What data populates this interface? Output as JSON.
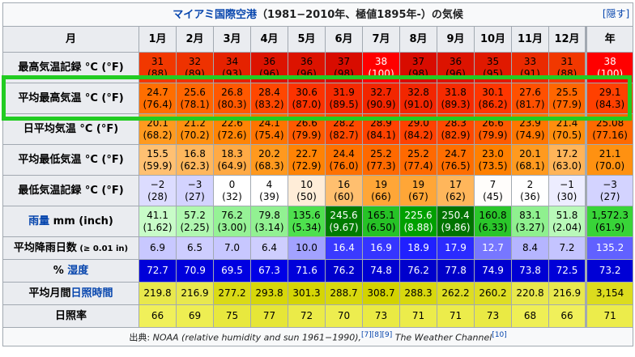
{
  "caption": {
    "title": "マイアミ国際空港",
    "rest": "（1981−2010年、極値1895年-）の気候",
    "hide": "[隠す]"
  },
  "header": {
    "corner": "月",
    "months": [
      "1月",
      "2月",
      "3月",
      "4月",
      "5月",
      "6月",
      "7月",
      "8月",
      "9月",
      "10月",
      "11月",
      "12月"
    ],
    "year": "年"
  },
  "rows": [
    {
      "label": "最高気温記録 °C (°F)",
      "link": false,
      "two_line": true,
      "cells": [
        {
          "a": "31",
          "b": "(88)",
          "bg": "#f13800",
          "fg": "#000000"
        },
        {
          "a": "32",
          "b": "(89)",
          "bg": "#ee3200",
          "fg": "#000000"
        },
        {
          "a": "34",
          "b": "(93)",
          "bg": "#e52200",
          "fg": "#000000"
        },
        {
          "a": "36",
          "b": "(96)",
          "bg": "#dc1300",
          "fg": "#000000"
        },
        {
          "a": "36",
          "b": "(96)",
          "bg": "#dc1300",
          "fg": "#000000"
        },
        {
          "a": "37",
          "b": "(98)",
          "bg": "#d80c00",
          "fg": "#000000"
        },
        {
          "a": "38",
          "b": "(100)",
          "bg": "#ff0000",
          "fg": "#ffffff"
        },
        {
          "a": "37",
          "b": "(98)",
          "bg": "#d80c00",
          "fg": "#000000"
        },
        {
          "a": "36",
          "b": "(96)",
          "bg": "#dc1300",
          "fg": "#000000"
        },
        {
          "a": "35",
          "b": "(95)",
          "bg": "#e01900",
          "fg": "#000000"
        },
        {
          "a": "33",
          "b": "(91)",
          "bg": "#ea2a00",
          "fg": "#000000"
        },
        {
          "a": "31",
          "b": "(88)",
          "bg": "#f13800",
          "fg": "#000000"
        },
        {
          "a": "38",
          "b": "(100)",
          "bg": "#ff0000",
          "fg": "#ffffff"
        }
      ]
    },
    {
      "label": "平均最高気温 °C (°F)",
      "link": false,
      "two_line": true,
      "cells": [
        {
          "a": "24.7",
          "b": "(76.4)",
          "bg": "#ff6e00",
          "fg": "#000000"
        },
        {
          "a": "25.6",
          "b": "(78.1)",
          "bg": "#ff6500",
          "fg": "#000000"
        },
        {
          "a": "26.8",
          "b": "(80.3)",
          "bg": "#ff5800",
          "fg": "#000000"
        },
        {
          "a": "28.4",
          "b": "(83.2)",
          "bg": "#ff4700",
          "fg": "#000000"
        },
        {
          "a": "30.6",
          "b": "(87.0)",
          "bg": "#fc3300",
          "fg": "#000000"
        },
        {
          "a": "31.9",
          "b": "(89.5)",
          "bg": "#f52a00",
          "fg": "#000000"
        },
        {
          "a": "32.7",
          "b": "(90.9)",
          "bg": "#f22600",
          "fg": "#000000"
        },
        {
          "a": "32.8",
          "b": "(91.0)",
          "bg": "#f22600",
          "fg": "#000000"
        },
        {
          "a": "31.8",
          "b": "(89.3)",
          "bg": "#f62b00",
          "fg": "#000000"
        },
        {
          "a": "30.1",
          "b": "(86.2)",
          "bg": "#fe3600",
          "fg": "#000000"
        },
        {
          "a": "27.6",
          "b": "(81.7)",
          "bg": "#ff5000",
          "fg": "#000000"
        },
        {
          "a": "25.5",
          "b": "(77.9)",
          "bg": "#ff6600",
          "fg": "#000000"
        },
        {
          "a": "29.1",
          "b": "(84.3)",
          "bg": "#ff4000",
          "fg": "#000000"
        }
      ]
    },
    {
      "label": "日平均気温 °C (°F)",
      "link": false,
      "two_line": true,
      "cells": [
        {
          "a": "20.1",
          "b": "(68.2)",
          "bg": "#ff9a1f",
          "fg": "#000000"
        },
        {
          "a": "21.2",
          "b": "(70.2)",
          "bg": "#ff9010",
          "fg": "#000000"
        },
        {
          "a": "22.6",
          "b": "(72.6)",
          "bg": "#ff8405",
          "fg": "#000000"
        },
        {
          "a": "24.1",
          "b": "(75.4)",
          "bg": "#ff7400",
          "fg": "#000000"
        },
        {
          "a": "26.6",
          "b": "(79.9)",
          "bg": "#ff5a00",
          "fg": "#000000"
        },
        {
          "a": "28.2",
          "b": "(82.7)",
          "bg": "#ff4a00",
          "fg": "#000000"
        },
        {
          "a": "28.9",
          "b": "(84.1)",
          "bg": "#ff4200",
          "fg": "#000000"
        },
        {
          "a": "29.0",
          "b": "(84.2)",
          "bg": "#ff4100",
          "fg": "#000000"
        },
        {
          "a": "28.3",
          "b": "(82.9)",
          "bg": "#ff4900",
          "fg": "#000000"
        },
        {
          "a": "26.6",
          "b": "(79.9)",
          "bg": "#ff5a00",
          "fg": "#000000"
        },
        {
          "a": "23.9",
          "b": "(74.9)",
          "bg": "#ff7600",
          "fg": "#000000"
        },
        {
          "a": "21.4",
          "b": "(70.5)",
          "bg": "#ff8e0e",
          "fg": "#000000"
        },
        {
          "a": "25.08",
          "b": "(77.16)",
          "bg": "#ff6a00",
          "fg": "#000000"
        }
      ]
    },
    {
      "label": "平均最低気温 °C (°F)",
      "link": false,
      "two_line": true,
      "cells": [
        {
          "a": "15.5",
          "b": "(59.9)",
          "bg": "#ffc072",
          "fg": "#000000"
        },
        {
          "a": "16.8",
          "b": "(62.3)",
          "bg": "#ffb75e",
          "fg": "#000000"
        },
        {
          "a": "18.3",
          "b": "(64.9)",
          "bg": "#ffaa45",
          "fg": "#000000"
        },
        {
          "a": "20.2",
          "b": "(68.3)",
          "bg": "#ff991e",
          "fg": "#000000"
        },
        {
          "a": "22.7",
          "b": "(72.9)",
          "bg": "#ff8304",
          "fg": "#000000"
        },
        {
          "a": "24.4",
          "b": "(76.0)",
          "bg": "#ff7100",
          "fg": "#000000"
        },
        {
          "a": "25.2",
          "b": "(77.3)",
          "bg": "#ff6900",
          "fg": "#000000"
        },
        {
          "a": "25.2",
          "b": "(77.4)",
          "bg": "#ff6900",
          "fg": "#000000"
        },
        {
          "a": "24.7",
          "b": "(76.5)",
          "bg": "#ff6e00",
          "fg": "#000000"
        },
        {
          "a": "23.0",
          "b": "(73.5)",
          "bg": "#ff8000",
          "fg": "#000000"
        },
        {
          "a": "20.1",
          "b": "(68.1)",
          "bg": "#ff9a1f",
          "fg": "#000000"
        },
        {
          "a": "17.2",
          "b": "(63.0)",
          "bg": "#ffb459",
          "fg": "#000000"
        },
        {
          "a": "21.1",
          "b": "(70.0)",
          "bg": "#ff9111",
          "fg": "#000000"
        }
      ]
    },
    {
      "label": "最低気温記録 °C (°F)",
      "link": false,
      "two_line": true,
      "cells": [
        {
          "a": "−2",
          "b": "(28)",
          "bg": "#dcdcff",
          "fg": "#000000"
        },
        {
          "a": "−3",
          "b": "(27)",
          "bg": "#d3d3ff",
          "fg": "#000000"
        },
        {
          "a": "0",
          "b": "(32)",
          "bg": "#ffffff",
          "fg": "#000000"
        },
        {
          "a": "4",
          "b": "(39)",
          "bg": "#ffffff",
          "fg": "#000000"
        },
        {
          "a": "10",
          "b": "(50)",
          "bg": "#ffedd8",
          "fg": "#000000"
        },
        {
          "a": "16",
          "b": "(60)",
          "bg": "#ffbf6f",
          "fg": "#000000"
        },
        {
          "a": "19",
          "b": "(66)",
          "bg": "#ffa637",
          "fg": "#000000"
        },
        {
          "a": "19",
          "b": "(67)",
          "bg": "#ffa637",
          "fg": "#000000"
        },
        {
          "a": "17",
          "b": "(62)",
          "bg": "#ffb65b",
          "fg": "#000000"
        },
        {
          "a": "7",
          "b": "(45)",
          "bg": "#fffdfb",
          "fg": "#000000"
        },
        {
          "a": "2",
          "b": "(36)",
          "bg": "#ffffff",
          "fg": "#000000"
        },
        {
          "a": "−1",
          "b": "(30)",
          "bg": "#ededff",
          "fg": "#000000"
        },
        {
          "a": "−3",
          "b": "(27)",
          "bg": "#d3d3ff",
          "fg": "#000000"
        }
      ]
    },
    {
      "label_link": "雨量",
      "label": " mm (inch)",
      "link": true,
      "two_line": true,
      "cells": [
        {
          "a": "41.1",
          "b": "(1.62)",
          "bg": "#c8fcc8",
          "fg": "#000000"
        },
        {
          "a": "57.2",
          "b": "(2.25)",
          "bg": "#b0f8b0",
          "fg": "#000000"
        },
        {
          "a": "76.2",
          "b": "(3.00)",
          "bg": "#96f296",
          "fg": "#000000"
        },
        {
          "a": "79.8",
          "b": "(3.14)",
          "bg": "#92f192",
          "fg": "#000000"
        },
        {
          "a": "135.6",
          "b": "(5.34)",
          "bg": "#4ee04e",
          "fg": "#000000"
        },
        {
          "a": "245.6",
          "b": "(9.67)",
          "bg": "#007c00",
          "fg": "#ffffff"
        },
        {
          "a": "165.1",
          "b": "(6.50)",
          "bg": "#26c226",
          "fg": "#000000"
        },
        {
          "a": "225.6",
          "b": "(8.88)",
          "bg": "#00a000",
          "fg": "#ffffff"
        },
        {
          "a": "250.4",
          "b": "(9.86)",
          "bg": "#007400",
          "fg": "#ffffff"
        },
        {
          "a": "160.8",
          "b": "(6.33)",
          "bg": "#2ac62a",
          "fg": "#000000"
        },
        {
          "a": "83.1",
          "b": "(3.27)",
          "bg": "#8ff08f",
          "fg": "#000000"
        },
        {
          "a": "51.8",
          "b": "(2.04)",
          "bg": "#b9f9b9",
          "fg": "#000000"
        },
        {
          "a": "1,572.3",
          "b": "(61.9)",
          "bg": "#38d438",
          "fg": "#000000"
        }
      ]
    },
    {
      "label": "平均降雨日数",
      "label_small": " (≥ 0.01 in)",
      "link": false,
      "two_line": false,
      "cells": [
        {
          "a": "6.9",
          "bg": "#c8c8ff",
          "fg": "#000000"
        },
        {
          "a": "6.5",
          "bg": "#cdcdff",
          "fg": "#000000"
        },
        {
          "a": "7.0",
          "bg": "#c7c7ff",
          "fg": "#000000"
        },
        {
          "a": "6.4",
          "bg": "#cecefe",
          "fg": "#000000"
        },
        {
          "a": "10.0",
          "bg": "#a2a2ff",
          "fg": "#000000"
        },
        {
          "a": "16.4",
          "bg": "#3a3aff",
          "fg": "#ffffff"
        },
        {
          "a": "16.9",
          "bg": "#3535ff",
          "fg": "#ffffff"
        },
        {
          "a": "18.9",
          "bg": "#2020ff",
          "fg": "#ffffff"
        },
        {
          "a": "17.9",
          "bg": "#2b2bff",
          "fg": "#ffffff"
        },
        {
          "a": "12.7",
          "bg": "#7777ff",
          "fg": "#ffffff"
        },
        {
          "a": "8.4",
          "bg": "#b5b5ff",
          "fg": "#000000"
        },
        {
          "a": "7.2",
          "bg": "#c4c4ff",
          "fg": "#000000"
        },
        {
          "a": "135.2",
          "bg": "#6161ff",
          "fg": "#ffffff"
        }
      ]
    },
    {
      "label": "% ",
      "label_link": "湿度",
      "link": true,
      "two_line": false,
      "cells": [
        {
          "a": "72.7",
          "bg": "#0000d9",
          "fg": "#ffffff"
        },
        {
          "a": "70.9",
          "bg": "#0000dc",
          "fg": "#ffffff"
        },
        {
          "a": "69.5",
          "bg": "#0000e1",
          "fg": "#ffffff"
        },
        {
          "a": "67.3",
          "bg": "#0000e6",
          "fg": "#ffffff"
        },
        {
          "a": "71.6",
          "bg": "#0000da",
          "fg": "#ffffff"
        },
        {
          "a": "76.2",
          "bg": "#0000cc",
          "fg": "#ffffff"
        },
        {
          "a": "74.8",
          "bg": "#0000d1",
          "fg": "#ffffff"
        },
        {
          "a": "76.2",
          "bg": "#0000cc",
          "fg": "#ffffff"
        },
        {
          "a": "77.8",
          "bg": "#0000c8",
          "fg": "#ffffff"
        },
        {
          "a": "74.9",
          "bg": "#0000d0",
          "fg": "#ffffff"
        },
        {
          "a": "73.8",
          "bg": "#0000d3",
          "fg": "#ffffff"
        },
        {
          "a": "72.5",
          "bg": "#0000d8",
          "fg": "#ffffff"
        },
        {
          "a": "73.2",
          "bg": "#0000d6",
          "fg": "#ffffff"
        }
      ]
    },
    {
      "label": "平均月間",
      "label_link": "日照時間",
      "link_after": true,
      "two_line": false,
      "cells": [
        {
          "a": "219.8",
          "bg": "#e8e84c",
          "fg": "#000000"
        },
        {
          "a": "216.9",
          "bg": "#e8e84e",
          "fg": "#000000"
        },
        {
          "a": "277.2",
          "bg": "#dada16",
          "fg": "#000000"
        },
        {
          "a": "293.8",
          "bg": "#d7d70a",
          "fg": "#000000"
        },
        {
          "a": "301.3",
          "bg": "#d5d505",
          "fg": "#000000"
        },
        {
          "a": "288.7",
          "bg": "#d8d80e",
          "fg": "#000000"
        },
        {
          "a": "308.7",
          "bg": "#d3d300",
          "fg": "#000000"
        },
        {
          "a": "288.3",
          "bg": "#d8d80e",
          "fg": "#000000"
        },
        {
          "a": "262.2",
          "bg": "#dddd22",
          "fg": "#000000"
        },
        {
          "a": "260.2",
          "bg": "#dede24",
          "fg": "#000000"
        },
        {
          "a": "220.8",
          "bg": "#e8e84c",
          "fg": "#000000"
        },
        {
          "a": "216.9",
          "bg": "#e8e84e",
          "fg": "#000000"
        },
        {
          "a": "3,154",
          "bg": "#dcdc1e",
          "fg": "#000000"
        }
      ]
    },
    {
      "label": "日照率",
      "link": false,
      "two_line": false,
      "cells": [
        {
          "a": "66",
          "bg": "#f0f05a",
          "fg": "#000000"
        },
        {
          "a": "69",
          "bg": "#eeee52",
          "fg": "#000000"
        },
        {
          "a": "75",
          "bg": "#e8e83e",
          "fg": "#000000"
        },
        {
          "a": "77",
          "bg": "#e6e637",
          "fg": "#000000"
        },
        {
          "a": "72",
          "bg": "#ebeb48",
          "fg": "#000000"
        },
        {
          "a": "70",
          "bg": "#eded4f",
          "fg": "#000000"
        },
        {
          "a": "73",
          "bg": "#eaea44",
          "fg": "#000000"
        },
        {
          "a": "71",
          "bg": "#ecec4b",
          "fg": "#000000"
        },
        {
          "a": "71",
          "bg": "#ecec4b",
          "fg": "#000000"
        },
        {
          "a": "73",
          "bg": "#eaea44",
          "fg": "#000000"
        },
        {
          "a": "68",
          "bg": "#efef55",
          "fg": "#000000"
        },
        {
          "a": "66",
          "bg": "#f0f05a",
          "fg": "#000000"
        },
        {
          "a": "71",
          "bg": "#ecec4b",
          "fg": "#000000"
        }
      ]
    }
  ],
  "source": {
    "prefix": "出典: ",
    "text1": "NOAA (relative humidity and sun 1961−1990),",
    "refs1": "[7][8][9]",
    "text2": " The Weather Channel",
    "refs2": "[10]"
  }
}
